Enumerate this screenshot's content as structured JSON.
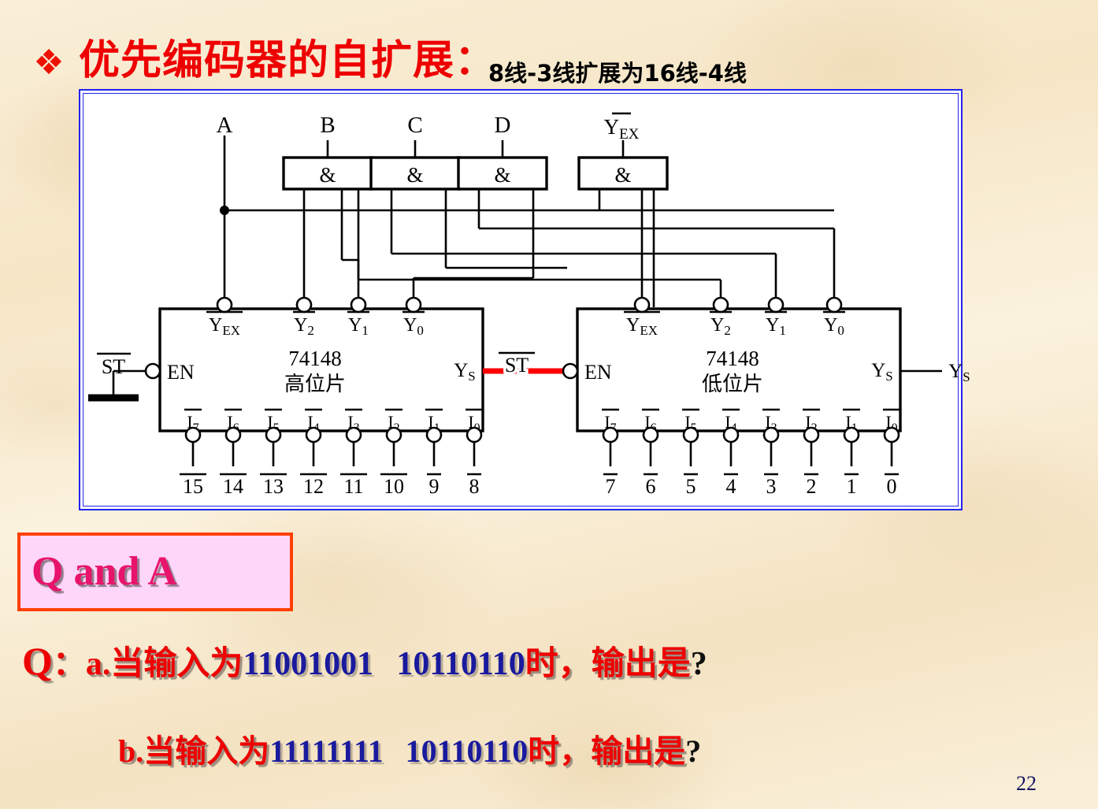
{
  "slide": {
    "bullet_icon": "diamond-bullet-icon",
    "title": "优先编码器的自扩展：",
    "subtitle": "8线-3线扩展为16线-4线",
    "page_number": "22"
  },
  "colors": {
    "title_red": "#ee0000",
    "frame_blue": "#2222ee",
    "qa_box_bg": "#fdd6fa",
    "qa_box_border": "#ff4000",
    "qa_text": "#e8146b",
    "binary_blue": "#1a1a9e",
    "link_red": "#ff0000",
    "background": "#f7e9cc"
  },
  "diagram": {
    "top_labels": [
      "A",
      "B",
      "C",
      "D",
      "Y̅EX"
    ],
    "top_label_plain": {
      "a": "A",
      "b": "B",
      "c": "C",
      "d": "D",
      "yex": "Y",
      "yex_sub": "EX"
    },
    "gates": [
      {
        "symbol": "&"
      },
      {
        "symbol": "&"
      },
      {
        "symbol": "&"
      },
      {
        "symbol": "&"
      }
    ],
    "chips": [
      {
        "id": "high-chip",
        "part": "74148",
        "role": "高位片",
        "enable_label": "EN",
        "st_label": "ST",
        "ys_label": "Y",
        "ys_sub": "S",
        "outputs": [
          {
            "name": "Y",
            "sub": "EX"
          },
          {
            "name": "Y",
            "sub": "2"
          },
          {
            "name": "Y",
            "sub": "1"
          },
          {
            "name": "Y",
            "sub": "0"
          }
        ],
        "inputs": [
          {
            "name": "I",
            "sub": "7"
          },
          {
            "name": "I",
            "sub": "6"
          },
          {
            "name": "I",
            "sub": "5"
          },
          {
            "name": "I",
            "sub": "4"
          },
          {
            "name": "I",
            "sub": "3"
          },
          {
            "name": "I",
            "sub": "2"
          },
          {
            "name": "I",
            "sub": "1"
          },
          {
            "name": "I",
            "sub": "0"
          }
        ],
        "input_numbers": [
          "15",
          "14",
          "13",
          "12",
          "11",
          "10",
          "9",
          "8"
        ],
        "has_ground": true
      },
      {
        "id": "low-chip",
        "part": "74148",
        "role": "低位片",
        "enable_label": "EN",
        "st_label": "ST",
        "ys_label": "Y",
        "ys_sub": "S",
        "outputs": [
          {
            "name": "Y",
            "sub": "EX"
          },
          {
            "name": "Y",
            "sub": "2"
          },
          {
            "name": "Y",
            "sub": "1"
          },
          {
            "name": "Y",
            "sub": "0"
          }
        ],
        "inputs": [
          {
            "name": "I",
            "sub": "7"
          },
          {
            "name": "I",
            "sub": "6"
          },
          {
            "name": "I",
            "sub": "5"
          },
          {
            "name": "I",
            "sub": "4"
          },
          {
            "name": "I",
            "sub": "3"
          },
          {
            "name": "I",
            "sub": "2"
          },
          {
            "name": "I",
            "sub": "1"
          },
          {
            "name": "I",
            "sub": "0"
          }
        ],
        "input_numbers": [
          "7",
          "6",
          "5",
          "4",
          "3",
          "2",
          "1",
          "0"
        ],
        "has_ground": false
      }
    ],
    "output_right": {
      "name": "Y",
      "sub": "S"
    }
  },
  "qa": {
    "box_title": "Q and A",
    "q_prefix": "Q",
    "q_colon": "：",
    "lines": [
      {
        "marker": "a.",
        "lead": "当输入为",
        "value_high": "11001001",
        "value_low": "10110110",
        "tail": "时，输出是",
        "mark": "?"
      },
      {
        "marker": "b.",
        "lead": "当输入为",
        "value_high": "11111111",
        "value_low": "10110110",
        "tail": "时，输出是",
        "mark": "?"
      }
    ]
  }
}
